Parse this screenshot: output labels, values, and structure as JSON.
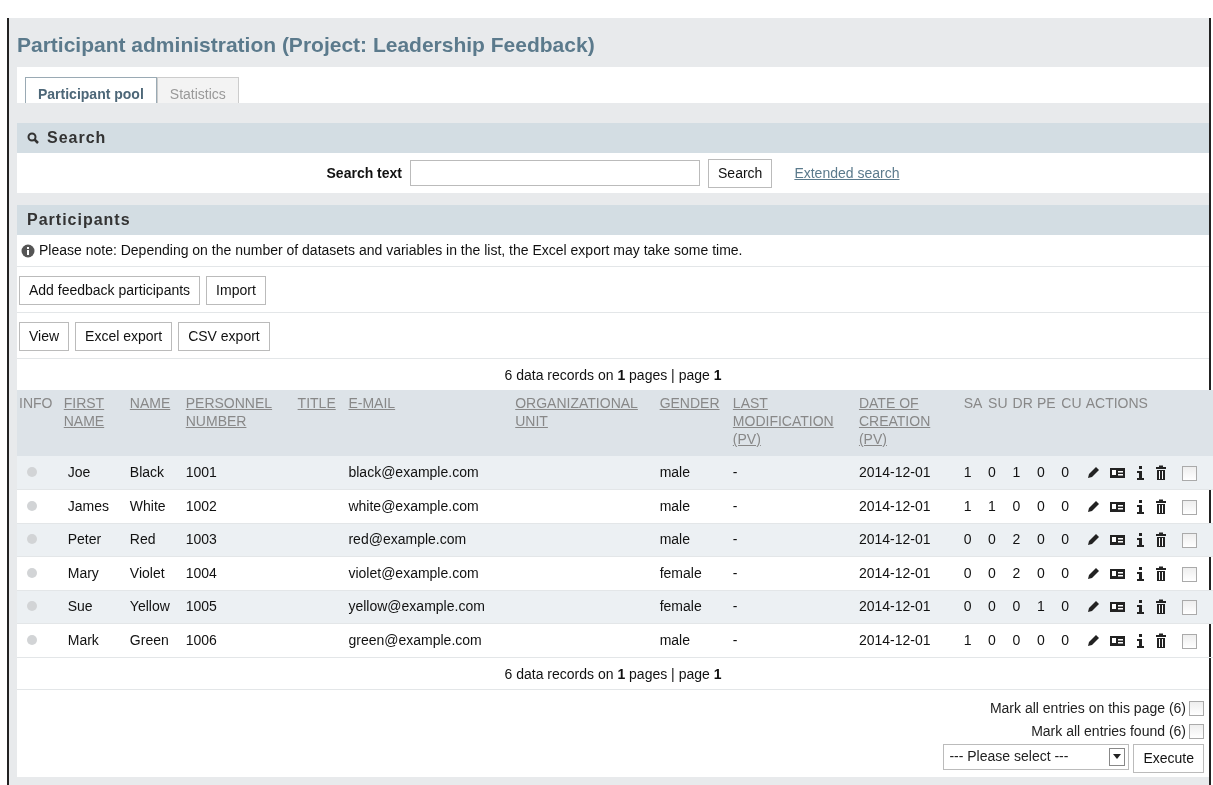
{
  "page_title": "Participant administration (Project: Leadership Feedback)",
  "tabs": [
    {
      "label": "Participant pool",
      "selected": true
    },
    {
      "label": "Statistics",
      "selected": false
    }
  ],
  "search": {
    "heading": "Search",
    "label": "Search text",
    "button": "Search",
    "link": "Extended search"
  },
  "participants": {
    "heading": "Participants",
    "note": "Please note: Depending on the number of datasets and variables in the list, the Excel export may take some time.",
    "button_rows": [
      [
        "Add feedback participants",
        "Import"
      ],
      [
        "View",
        "Excel export",
        "CSV export"
      ]
    ],
    "pager_top": "6 data records on **1** pages | page **1**",
    "columns": [
      {
        "label": "INFO",
        "sortable": false
      },
      {
        "label": "FIRST NAME",
        "sortable": true
      },
      {
        "label": "NAME",
        "sortable": true
      },
      {
        "label": "PERSONNEL NUMBER",
        "sortable": true
      },
      {
        "label": "TITLE",
        "sortable": true
      },
      {
        "label": "E-MAIL",
        "sortable": true
      },
      {
        "label": "ORGANIZATIONAL UNIT",
        "sortable": true
      },
      {
        "label": "GENDER",
        "sortable": true
      },
      {
        "label": "LAST MODIFICATION (PV)",
        "sortable": true
      },
      {
        "label": "DATE OF CREATION (PV)",
        "sortable": true
      },
      {
        "label": "SA",
        "sortable": false
      },
      {
        "label": "SU",
        "sortable": false
      },
      {
        "label": "DR",
        "sortable": false
      },
      {
        "label": "PE",
        "sortable": false
      },
      {
        "label": "CU",
        "sortable": false
      },
      {
        "label": "ACTIONS",
        "sortable": false
      }
    ],
    "rows": [
      {
        "cells": [
          "",
          "Joe",
          "Black",
          "1001",
          "",
          "black@example.com",
          "",
          "male",
          "-",
          "2014-12-01",
          "1",
          "0",
          "1",
          "0",
          "0"
        ],
        "checked": false
      },
      {
        "cells": [
          "",
          "James",
          "White",
          "1002",
          "",
          "white@example.com",
          "",
          "male",
          "-",
          "2014-12-01",
          "1",
          "1",
          "0",
          "0",
          "0"
        ],
        "checked": false
      },
      {
        "cells": [
          "",
          "Peter",
          "Red",
          "1003",
          "",
          "red@example.com",
          "",
          "male",
          "-",
          "2014-12-01",
          "0",
          "0",
          "2",
          "0",
          "0"
        ],
        "checked": false
      },
      {
        "cells": [
          "",
          "Mary",
          "Violet",
          "1004",
          "",
          "violet@example.com",
          "",
          "female",
          "-",
          "2014-12-01",
          "0",
          "0",
          "2",
          "0",
          "0"
        ],
        "checked": false
      },
      {
        "cells": [
          "",
          "Sue",
          "Yellow",
          "1005",
          "",
          "yellow@example.com",
          "",
          "female",
          "-",
          "2014-12-01",
          "0",
          "0",
          "0",
          "1",
          "0"
        ],
        "checked": false
      },
      {
        "cells": [
          "",
          "Mark",
          "Green",
          "1006",
          "",
          "green@example.com",
          "",
          "male",
          "-",
          "2014-12-01",
          "1",
          "0",
          "0",
          "0",
          "0"
        ],
        "checked": false
      }
    ],
    "pager_bottom": "6 data records on **1** pages | page **1**",
    "mark_options": [
      {
        "label": "Mark all entries on this page (6)",
        "checked": false
      },
      {
        "label": "Mark all entries found (6)",
        "checked": false
      }
    ],
    "action_select": {
      "value": "--- Please select ---"
    },
    "execute_button": "Execute"
  }
}
